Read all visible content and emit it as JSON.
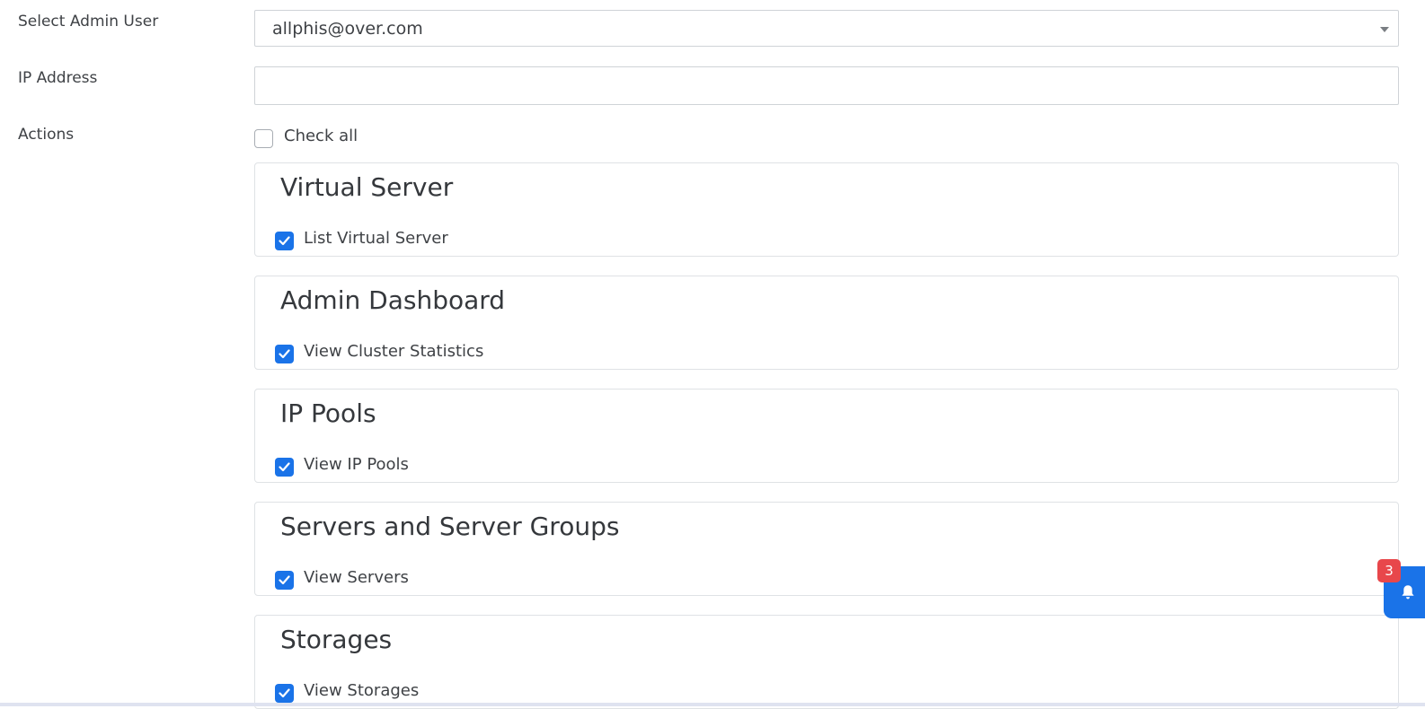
{
  "form": {
    "admin_user_label": "Select Admin User",
    "admin_user_value": "allphis@over.com",
    "ip_address_label": "IP Address",
    "ip_address_value": "",
    "actions_label": "Actions",
    "check_all_label": "Check all",
    "check_all_checked": false
  },
  "groups": [
    {
      "title": "Virtual Server",
      "permission": "List Virtual Server",
      "checked": true
    },
    {
      "title": "Admin Dashboard",
      "permission": "View Cluster Statistics",
      "checked": true
    },
    {
      "title": "IP Pools",
      "permission": "View IP Pools",
      "checked": true
    },
    {
      "title": "Servers and Server Groups",
      "permission": "View Servers",
      "checked": true
    },
    {
      "title": "Storages",
      "permission": "View Storages",
      "checked": true
    }
  ],
  "notifications": {
    "count": "3",
    "icon": "bell-icon"
  },
  "colors": {
    "accent": "#1a73e8",
    "badge": "#e8474b"
  }
}
